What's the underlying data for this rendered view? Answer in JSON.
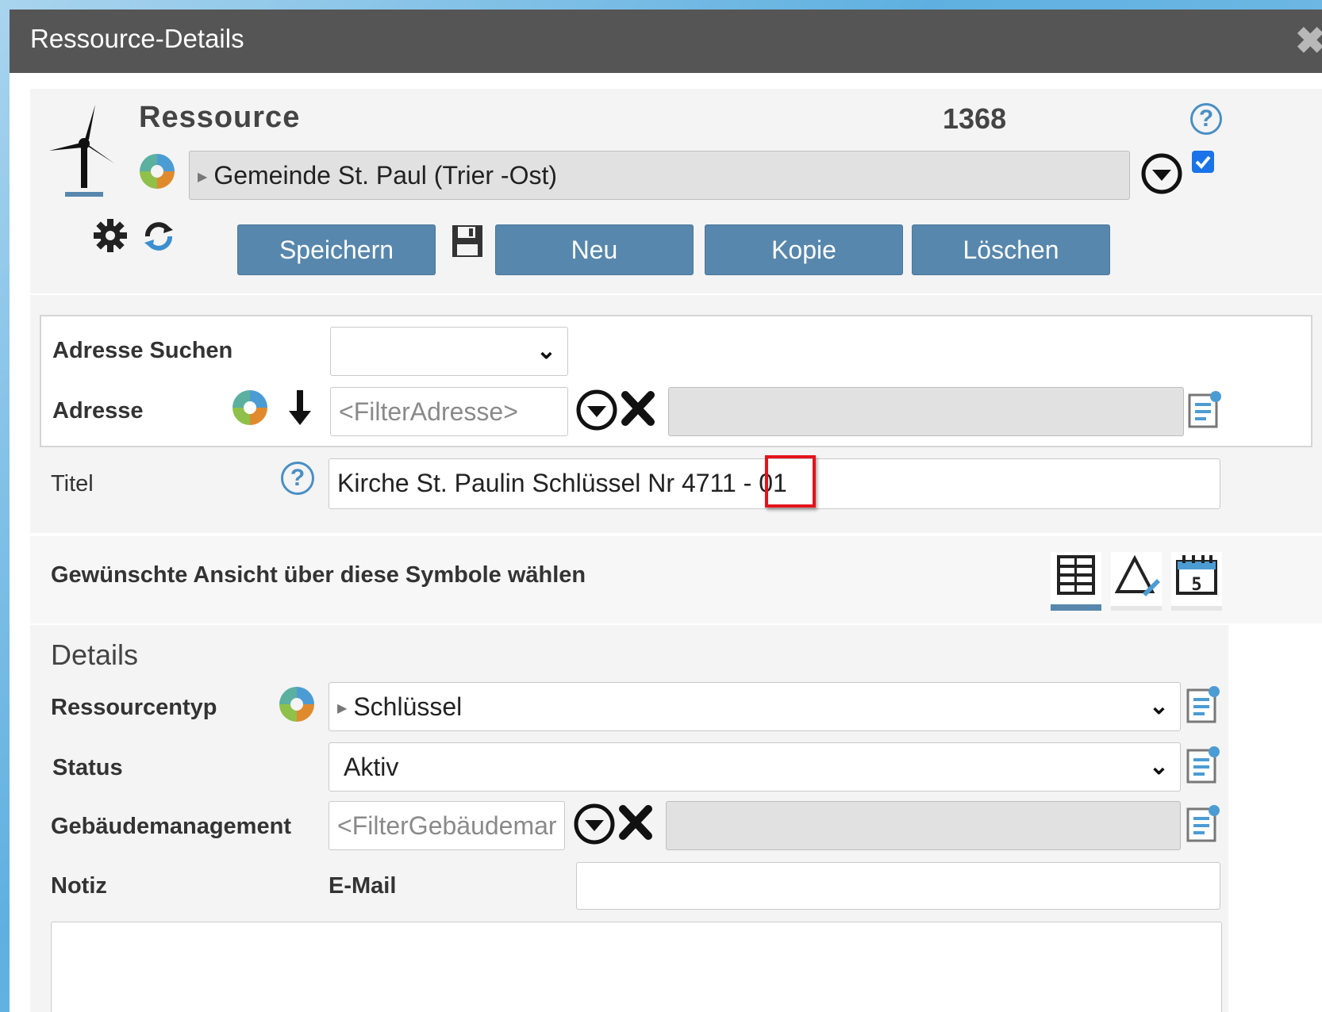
{
  "window": {
    "title": "Ressource-Details",
    "close_glyph": "✖"
  },
  "header": {
    "label": "Ressource",
    "id": "1368",
    "help_glyph": "?",
    "parent_value": "Gemeinde St. Paul (Trier -Ost)",
    "buttons": {
      "save": "Speichern",
      "new": "Neu",
      "copy": "Kopie",
      "delete": "Löschen"
    }
  },
  "address": {
    "search_label": "Adresse Suchen",
    "search_value": "",
    "label": "Adresse",
    "filter_placeholder": "<FilterAdresse>",
    "value": ""
  },
  "title_row": {
    "label": "Titel",
    "value": "Kirche St. Paulin Schlüssel Nr 4711 - 01"
  },
  "view": {
    "hint": "Gewünschte Ansicht über diese Symbole wählen",
    "calendar_number": "5"
  },
  "details": {
    "heading": "Details",
    "resource_type_label": "Ressourcentyp",
    "resource_type_value": "Schlüssel",
    "status_label": "Status",
    "status_value": "Aktiv",
    "building_label": "Gebäudemanagement",
    "building_placeholder": "<FilterGebäudemar",
    "building_value": "",
    "note_label": "Notiz",
    "email_label": "E-Mail",
    "email_value": ""
  },
  "colors": {
    "button": "#5787ad",
    "titlebar": "#555555",
    "highlight": "#e3141b",
    "checkbox": "#1a73e8"
  }
}
